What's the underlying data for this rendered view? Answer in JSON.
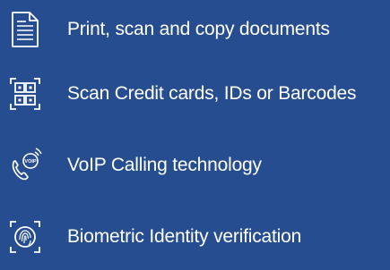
{
  "features": [
    {
      "icon": "document-icon",
      "label": "Print, scan and copy documents"
    },
    {
      "icon": "qr-scan-icon",
      "label": "Scan Credit cards, IDs or Barcodes"
    },
    {
      "icon": "voip-phone-icon",
      "label": "VoIP Calling technology"
    },
    {
      "icon": "fingerprint-scan-icon",
      "label": "Biometric Identity verification"
    }
  ],
  "voip_badge_text": "VOIP",
  "colors": {
    "background": "#264d8f",
    "foreground": "#ffffff"
  }
}
